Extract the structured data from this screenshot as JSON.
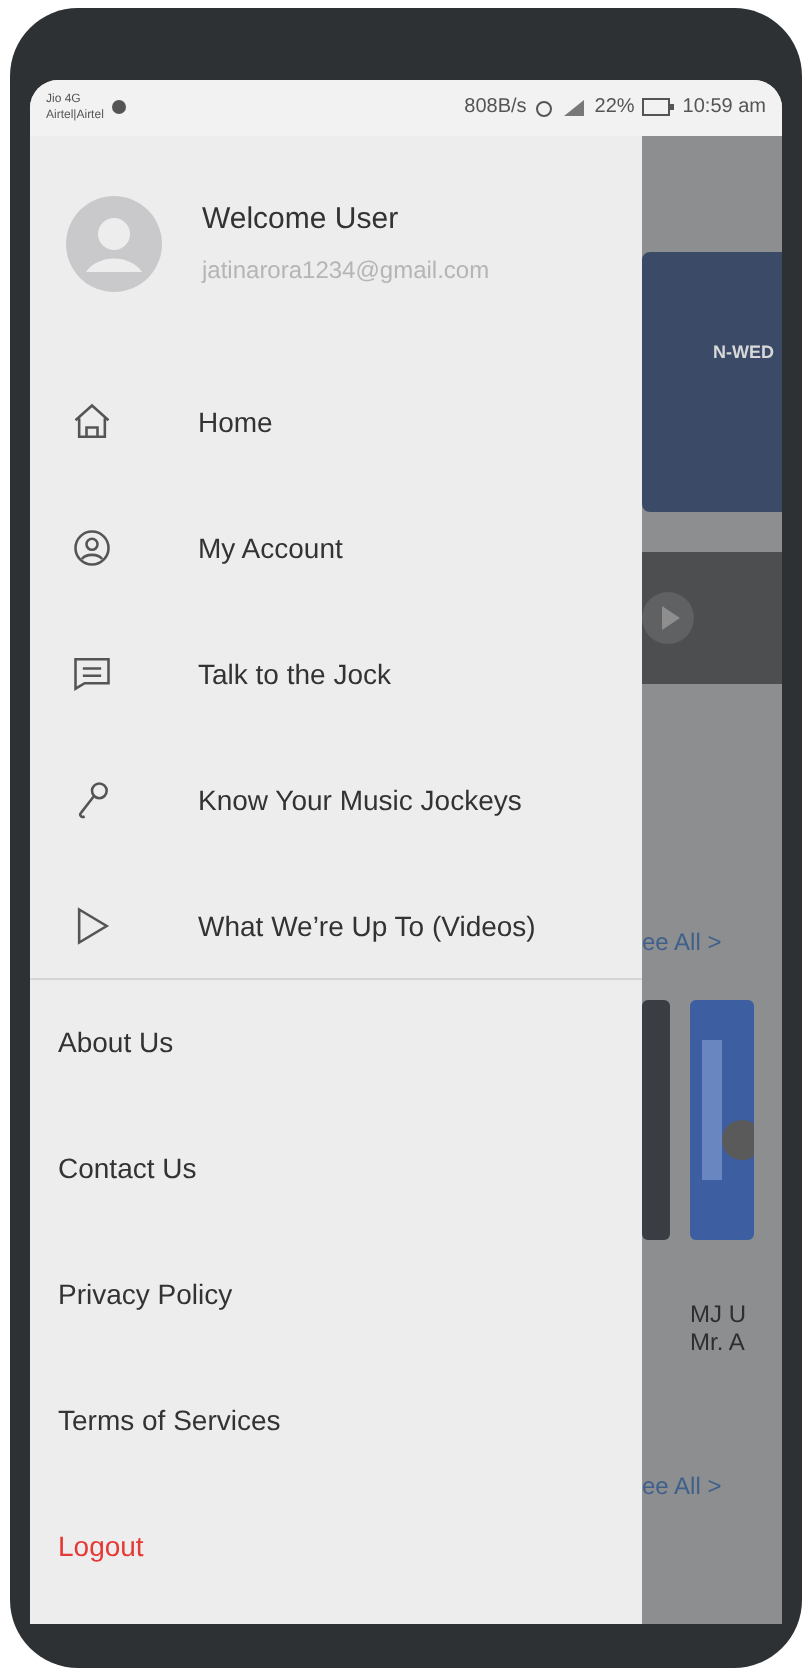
{
  "status_bar": {
    "carrier_1": "Jio 4G",
    "carrier_2": "Airtel|Airtel",
    "speed": "808B/s",
    "battery": "22%",
    "time": "10:59 am"
  },
  "drawer": {
    "user_name": "Welcome User",
    "email": "jatinarora1234@gmail.com",
    "menu": [
      {
        "kind": "home",
        "label": "Home"
      },
      {
        "kind": "account",
        "label": "My Account"
      },
      {
        "kind": "chat",
        "label": "Talk to the Jock"
      },
      {
        "kind": "mic",
        "label": "Know Your Music Jockeys"
      },
      {
        "kind": "play",
        "label": "What We’re Up To (Videos)"
      }
    ],
    "links": [
      {
        "label": "About Us",
        "kind": "normal"
      },
      {
        "label": "Contact Us",
        "kind": "normal"
      },
      {
        "label": "Privacy Policy",
        "kind": "normal"
      },
      {
        "label": "Terms of Services",
        "kind": "normal"
      },
      {
        "label": "Logout",
        "kind": "danger"
      }
    ]
  },
  "background": {
    "banner_text": "N-WED",
    "see_all_1": "ee All >",
    "caption_1": "MJ U",
    "caption_2": "Mr. A",
    "see_all_2": "ee All >"
  }
}
